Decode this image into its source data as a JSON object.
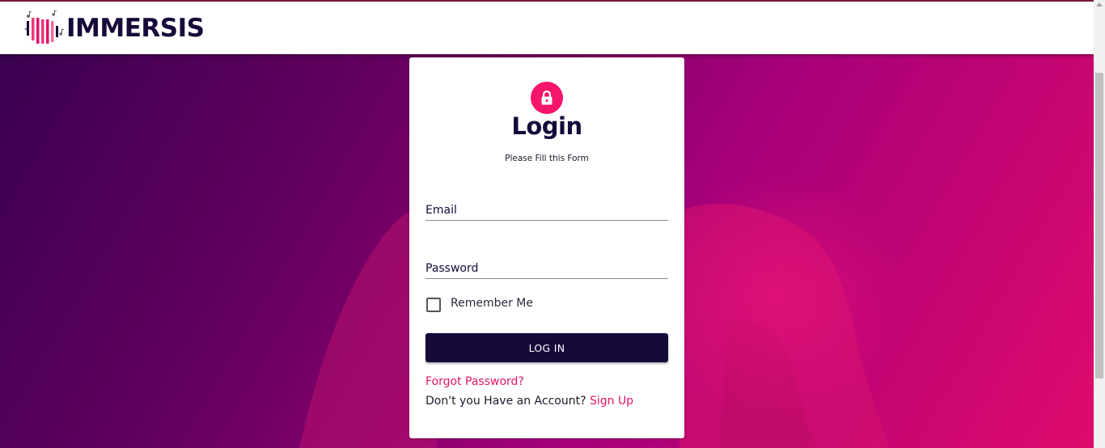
{
  "app": {
    "brand": "IMMERSIS"
  },
  "colors": {
    "accent": "#e5146a",
    "dark": "#150a3a",
    "gradient_start": "#3a0050",
    "gradient_end": "#df0a6c"
  },
  "login": {
    "icon": "lock-icon",
    "title": "Login",
    "subtitle": "Please Fill this Form",
    "email_placeholder": "Email",
    "password_placeholder": "Password",
    "remember_label": "Remember Me",
    "remember_checked": false,
    "submit_label": "LOG IN",
    "forgot_label": "Forgot Password?",
    "signup_prompt": "Don't you Have an Account?",
    "signup_label": "Sign Up"
  }
}
